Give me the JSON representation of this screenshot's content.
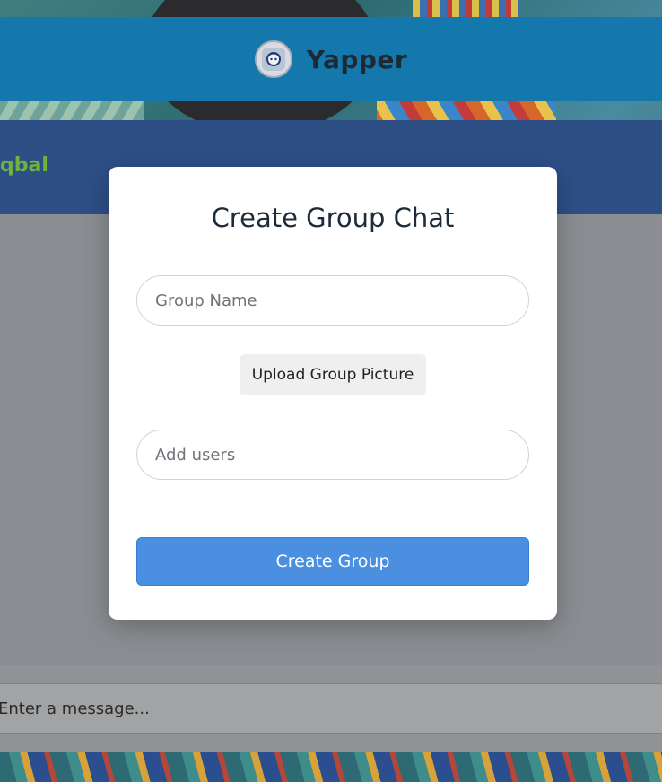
{
  "app": {
    "title": "Yapper",
    "logo_icon": "chat-face-icon"
  },
  "chat": {
    "partner_name": "qbal",
    "message_placeholder": "Enter a message..."
  },
  "modal": {
    "title": "Create Group Chat",
    "group_name_placeholder": "Group Name",
    "group_name_value": "",
    "upload_label": "Upload Group Picture",
    "add_users_placeholder": "Add users",
    "add_users_value": "",
    "create_label": "Create Group"
  },
  "colors": {
    "header": "#1578ac",
    "chat_header": "#2d4f86",
    "partner_name": "#6db33f",
    "primary_button": "#4a8fe0"
  }
}
